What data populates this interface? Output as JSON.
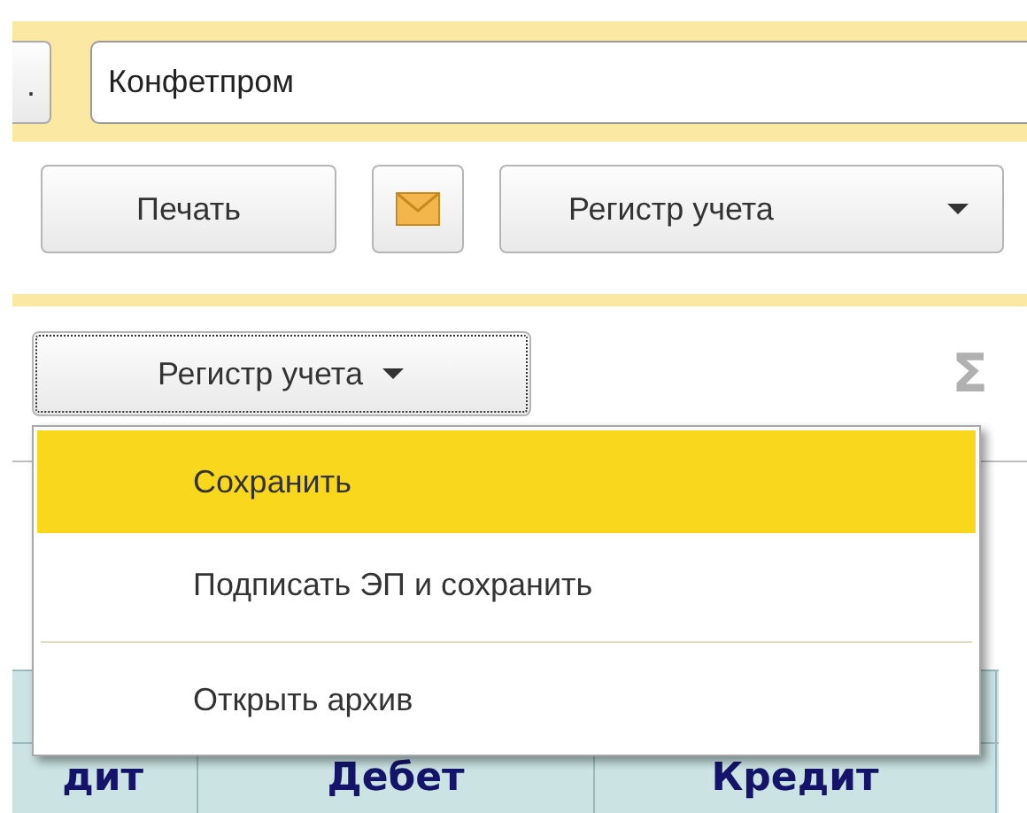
{
  "header": {
    "select_button": ".",
    "company_field": {
      "value": "Конфетпром"
    }
  },
  "toolbar": [
    {
      "kind": "text",
      "label": "Печать"
    },
    {
      "kind": "mail"
    },
    {
      "kind": "dropdown",
      "label": "Регистр учета"
    }
  ],
  "register_button": {
    "label": "Регистр учета",
    "focused": true
  },
  "sum_icon": "Σ",
  "table": {
    "rows": [
      [
        "дит",
        "Дебет",
        "Кредит"
      ]
    ]
  },
  "menu": {
    "items": [
      {
        "label": "Сохранить",
        "selected": true,
        "separator_before": false
      },
      {
        "label": "Подписать ЭП и сохранить",
        "selected": false,
        "separator_before": false
      },
      {
        "label": "Открыть архив",
        "selected": false,
        "separator_before": true
      }
    ]
  }
}
